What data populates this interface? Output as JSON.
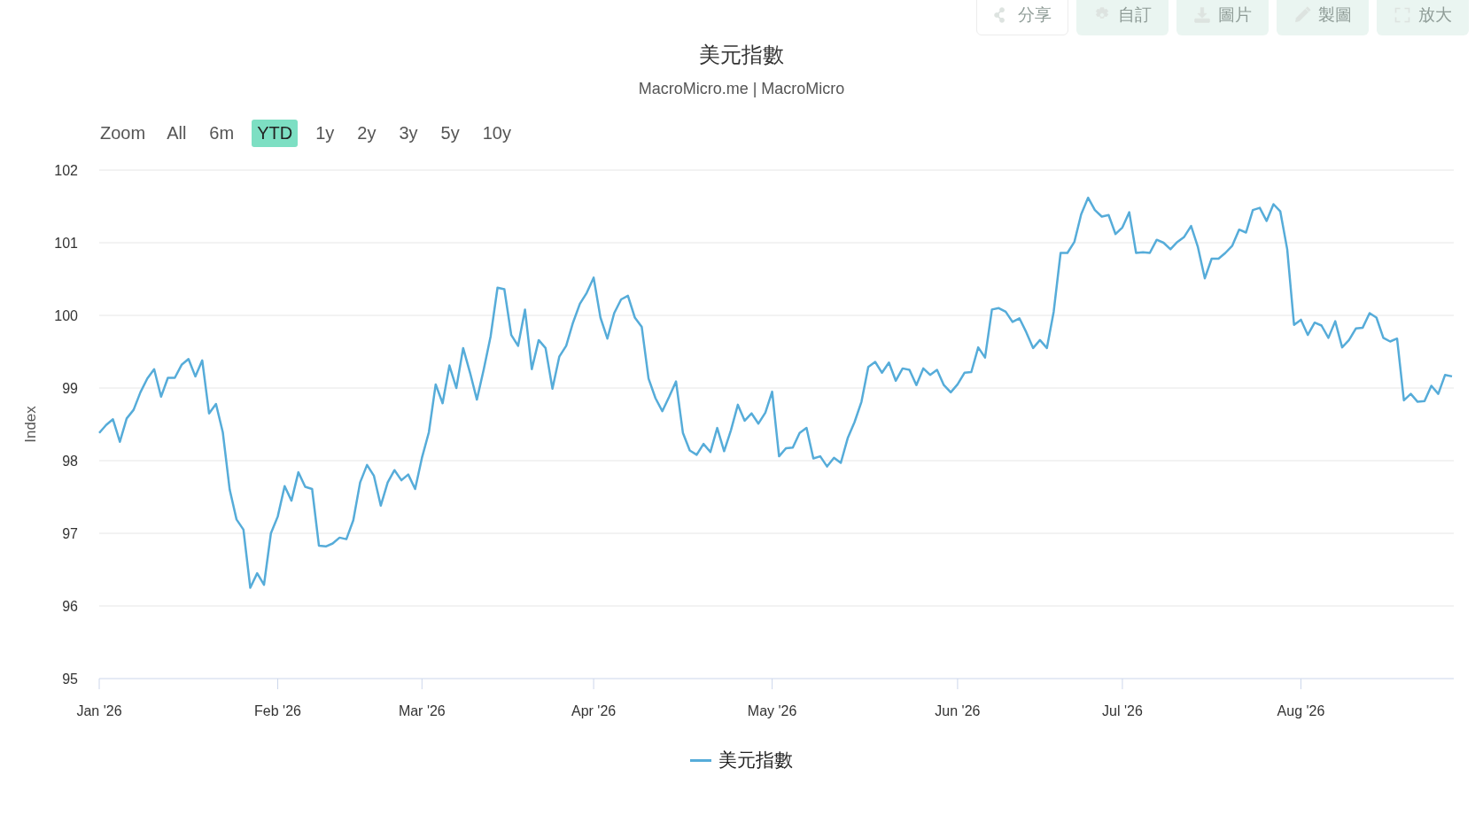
{
  "toolbar": [
    {
      "kind": "share",
      "label": "分享",
      "outlined": true
    },
    {
      "kind": "gear",
      "label": "自訂",
      "outlined": false
    },
    {
      "kind": "download",
      "label": "圖片",
      "outlined": false
    },
    {
      "kind": "pencil",
      "label": "製圖",
      "outlined": false
    },
    {
      "kind": "expand",
      "label": "放大",
      "outlined": false
    }
  ],
  "title": "美元指數",
  "subtitle": "MacroMicro.me | MacroMicro",
  "range_selector": {
    "label": "Zoom",
    "options": [
      {
        "label": "All",
        "selected": false
      },
      {
        "label": "6m",
        "selected": false
      },
      {
        "label": "YTD",
        "selected": true
      },
      {
        "label": "1y",
        "selected": false
      },
      {
        "label": "2y",
        "selected": false
      },
      {
        "label": "3y",
        "selected": false
      },
      {
        "label": "5y",
        "selected": false
      },
      {
        "label": "10y",
        "selected": false
      }
    ]
  },
  "chart_data": {
    "type": "line",
    "grid": true,
    "ylabel": "Index",
    "ylim": [
      95,
      102
    ],
    "yticks": [
      95,
      96,
      97,
      98,
      99,
      100,
      101,
      102
    ],
    "categories": [
      "Jan '26",
      null,
      null,
      null,
      null,
      null,
      null,
      null,
      null,
      null,
      null,
      null,
      null,
      null,
      null,
      null,
      null,
      null,
      null,
      null,
      null,
      null,
      null,
      null,
      null,
      null,
      "Feb '26",
      null,
      null,
      null,
      null,
      null,
      null,
      null,
      null,
      null,
      null,
      null,
      null,
      null,
      null,
      null,
      null,
      null,
      null,
      null,
      null,
      "Mar '26",
      null,
      null,
      null,
      null,
      null,
      null,
      null,
      null,
      null,
      null,
      null,
      null,
      null,
      null,
      null,
      null,
      null,
      null,
      null,
      null,
      null,
      null,
      null,
      null,
      "Apr '26",
      null,
      null,
      null,
      null,
      null,
      null,
      null,
      null,
      null,
      null,
      null,
      null,
      null,
      null,
      null,
      null,
      null,
      null,
      null,
      null,
      null,
      null,
      null,
      null,
      null,
      "May '26",
      null,
      null,
      null,
      null,
      null,
      null,
      null,
      null,
      null,
      null,
      null,
      null,
      null,
      null,
      null,
      null,
      null,
      null,
      null,
      null,
      null,
      null,
      null,
      null,
      null,
      null,
      "Jun '26",
      null,
      null,
      null,
      null,
      null,
      null,
      null,
      null,
      null,
      null,
      null,
      null,
      null,
      null,
      null,
      null,
      null,
      null,
      null,
      null,
      null,
      null,
      null,
      "Jul '26",
      null,
      null,
      null,
      null,
      null,
      null,
      null,
      null,
      null,
      null,
      null,
      null,
      null,
      null,
      null,
      null,
      null,
      null,
      null,
      null,
      null,
      null,
      null,
      null,
      null,
      "Aug '26",
      null,
      null,
      null,
      null,
      null,
      null,
      null,
      null,
      null,
      null,
      null,
      null,
      null,
      null,
      null,
      null,
      null,
      null,
      null,
      null,
      null,
      null
    ],
    "series": [
      {
        "name": "美元指數",
        "color": "#56acd9",
        "values": [
          98.38,
          98.49,
          98.57,
          98.26,
          98.58,
          98.7,
          98.94,
          99.13,
          99.26,
          98.88,
          99.14,
          99.14,
          99.32,
          99.4,
          99.16,
          99.38,
          98.65,
          98.78,
          98.39,
          97.6,
          97.19,
          97.05,
          96.25,
          96.45,
          96.29,
          97.0,
          97.23,
          97.65,
          97.45,
          97.84,
          97.64,
          97.61,
          96.83,
          96.82,
          96.86,
          96.94,
          96.92,
          97.18,
          97.7,
          97.94,
          97.79,
          97.38,
          97.7,
          97.87,
          97.73,
          97.81,
          97.61,
          98.04,
          98.39,
          99.05,
          98.79,
          99.31,
          99.0,
          99.55,
          99.21,
          98.84,
          99.26,
          99.71,
          100.38,
          100.36,
          99.73,
          99.58,
          100.08,
          99.26,
          99.66,
          99.55,
          98.99,
          99.43,
          99.58,
          99.9,
          100.16,
          100.31,
          100.52,
          99.97,
          99.68,
          100.03,
          100.22,
          100.27,
          99.97,
          99.84,
          99.13,
          98.86,
          98.68,
          98.88,
          99.09,
          98.38,
          98.14,
          98.08,
          98.23,
          98.12,
          98.45,
          98.13,
          98.42,
          98.77,
          98.55,
          98.65,
          98.51,
          98.66,
          98.95,
          98.06,
          98.17,
          98.18,
          98.38,
          98.45,
          98.03,
          98.06,
          97.92,
          98.04,
          97.97,
          98.31,
          98.53,
          98.81,
          99.29,
          99.36,
          99.21,
          99.35,
          99.1,
          99.27,
          99.25,
          99.04,
          99.27,
          99.18,
          99.25,
          99.04,
          98.94,
          99.05,
          99.21,
          99.22,
          99.56,
          99.42,
          100.08,
          100.1,
          100.05,
          99.91,
          99.96,
          99.77,
          99.55,
          99.66,
          99.55,
          100.05,
          100.86,
          100.86,
          101.01,
          101.39,
          101.62,
          101.45,
          101.36,
          101.38,
          101.12,
          101.21,
          101.42,
          100.86,
          100.87,
          100.86,
          101.04,
          101.0,
          100.91,
          101.01,
          101.08,
          101.23,
          100.94,
          100.51,
          100.78,
          100.78,
          100.86,
          100.96,
          101.18,
          101.14,
          101.45,
          101.48,
          101.3,
          101.53,
          101.43,
          100.91,
          99.87,
          99.94,
          99.73,
          99.9,
          99.86,
          99.69,
          99.92,
          99.56,
          99.66,
          99.82,
          99.83,
          100.03,
          99.97,
          99.69,
          99.64,
          99.68,
          98.83,
          98.92,
          98.81,
          98.82,
          99.03,
          98.92,
          99.18,
          99.16
        ]
      }
    ]
  }
}
